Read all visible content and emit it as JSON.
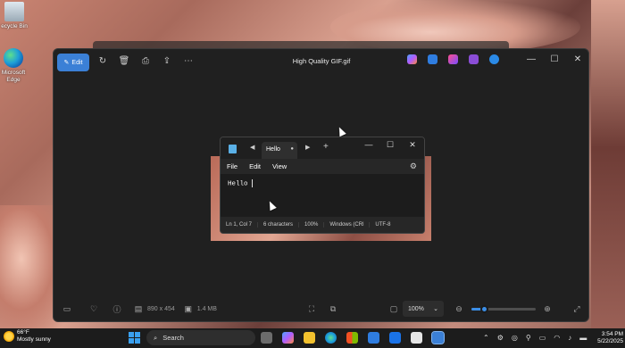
{
  "desktop": {
    "icons": [
      {
        "label": "ecycle Bin"
      },
      {
        "label": "Microsoft Edge"
      }
    ]
  },
  "photos": {
    "title": "High Quality GIF.gif",
    "edit_label": "Edit",
    "dimensions": "890 x 454",
    "file_size": "1.4 MB",
    "zoom": "100%",
    "zoom_level": 0.2
  },
  "notepad": {
    "tab_label": "Hello",
    "menu": [
      "File",
      "Edit",
      "View"
    ],
    "content": "Hello",
    "status": {
      "position": "Ln 1, Col 7",
      "chars": "6 characters",
      "zoom": "100%",
      "line_ending": "Windows (CRl",
      "encoding": "UTF-8"
    }
  },
  "taskbar": {
    "weather_temp": "66°F",
    "weather_desc": "Mostly sunny",
    "search_placeholder": "Search",
    "time": "3:54 PM",
    "date": "5/22/2025"
  }
}
